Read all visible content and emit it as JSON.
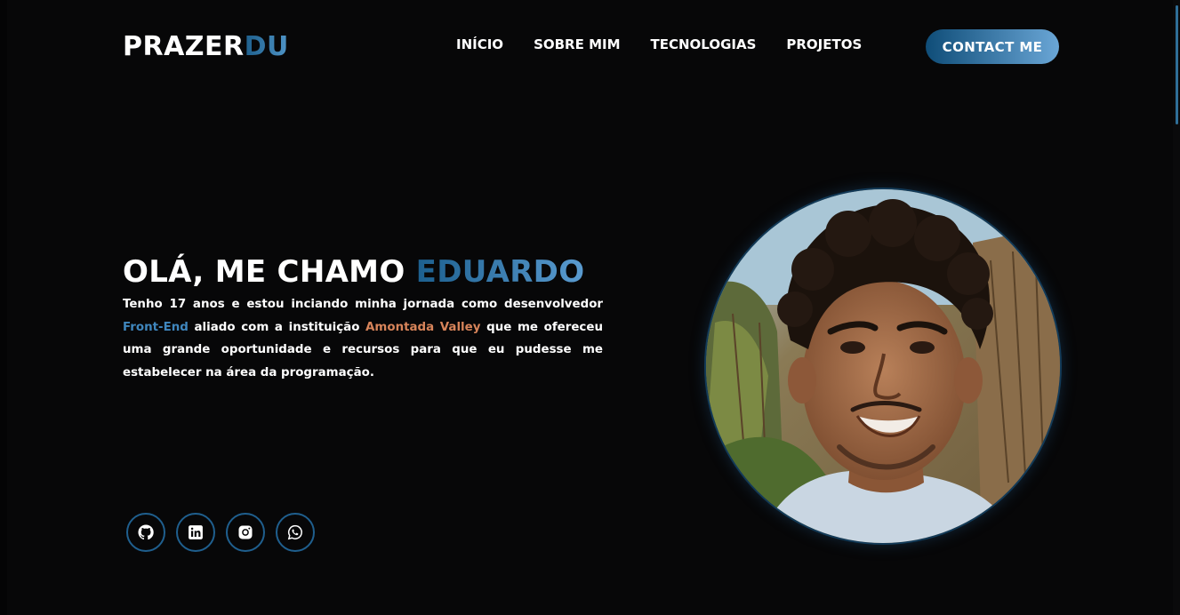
{
  "header": {
    "logo_part1": "PRAZER",
    "logo_part2": "DU",
    "nav": [
      "INÍCIO",
      "SOBRE MIM",
      "TECNOLOGIAS",
      "PROJETOS"
    ],
    "contact_label": "CONTACT ME"
  },
  "hero": {
    "title_prefix": "OLÁ, ME CHAMO ",
    "title_name": "EDUARDO",
    "bio": {
      "part1": "Tenho 17 anos e estou inciando minha jornada como desenvolvedor ",
      "highlight1": "Front-End",
      "part2": " aliado com a instituição ",
      "highlight2": "Amontada Valley",
      "part3": " que me ofereceu uma grande oportunidade e recursos para que eu pudesse me estabelecer na área da programação."
    }
  },
  "social": [
    {
      "icon": "github-icon"
    },
    {
      "icon": "linkedin-icon"
    },
    {
      "icon": "instagram-icon"
    },
    {
      "icon": "whatsapp-icon"
    }
  ],
  "colors": {
    "background": "#070708",
    "accent_blue": "#3f86bd",
    "accent_orange": "#d7845a",
    "button_gradient_start": "#0f4d78",
    "button_gradient_end": "#6aa6d6"
  }
}
